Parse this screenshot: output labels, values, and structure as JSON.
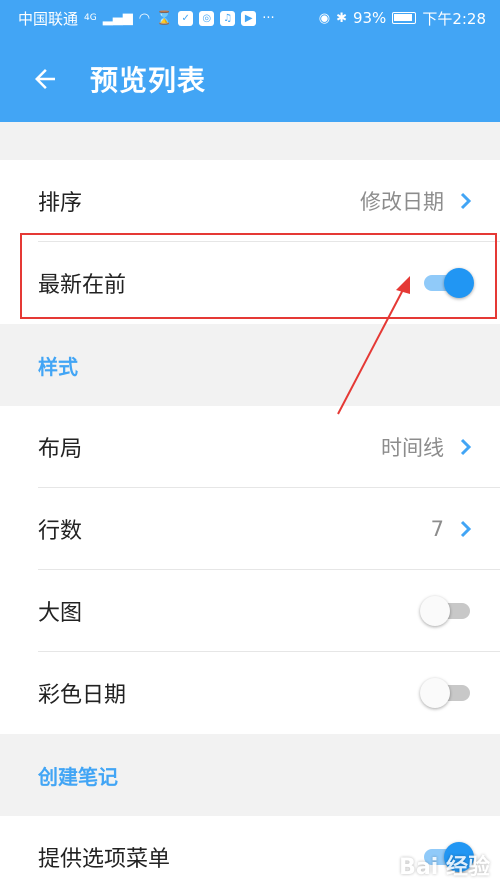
{
  "statusbar": {
    "carrier": "中国联通",
    "network": "4G",
    "battery_percent": "93%",
    "time": "下午2:28",
    "icons": [
      "signal-icon",
      "wifi-icon",
      "hourglass-icon",
      "app-icon",
      "app-icon",
      "music-icon",
      "play-icon",
      "more-icon",
      "eye-icon",
      "bluetooth-icon",
      "battery-icon"
    ]
  },
  "appbar": {
    "title": "预览列表"
  },
  "section1": {
    "rows": [
      {
        "label": "排序",
        "value": "修改日期"
      },
      {
        "label": "最新在前",
        "toggle": true
      }
    ]
  },
  "section_style": {
    "header": "样式",
    "rows": [
      {
        "label": "布局",
        "value": "时间线"
      },
      {
        "label": "行数",
        "value": "7"
      },
      {
        "label": "大图",
        "toggle": false
      },
      {
        "label": "彩色日期",
        "toggle": false
      }
    ]
  },
  "section_create": {
    "header": "创建笔记",
    "rows": [
      {
        "label": "提供选项菜单",
        "toggle": true
      }
    ]
  },
  "watermark": "Bai 经验",
  "colors": {
    "accent": "#42a5f5",
    "toggle_on": "#2196f3",
    "highlight": "#e53935"
  }
}
